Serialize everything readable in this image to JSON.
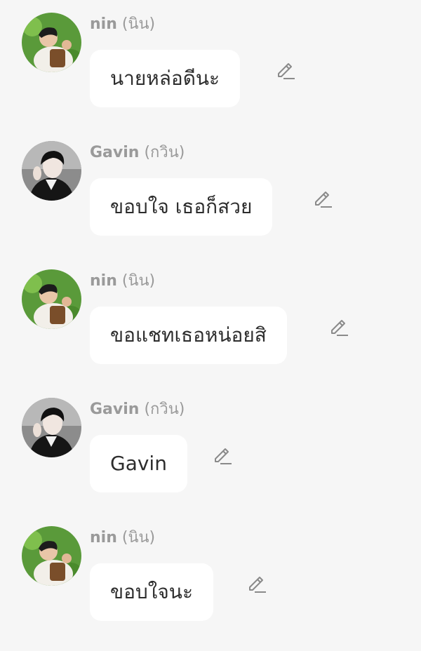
{
  "messages": [
    {
      "sender_name": "nin",
      "sender_alias": "(นิน)",
      "text": "นายหล่อดีนะ",
      "avatar": "nin-avatar",
      "edit_icon": "pencil-icon"
    },
    {
      "sender_name": "Gavin",
      "sender_alias": "(กวิน)",
      "text": "ขอบใจ เธอก็สวย",
      "avatar": "gavin-avatar",
      "edit_icon": "pencil-icon"
    },
    {
      "sender_name": "nin",
      "sender_alias": "(นิน)",
      "text": "ขอแชทเธอหน่อยสิ",
      "avatar": "nin-avatar",
      "edit_icon": "pencil-icon"
    },
    {
      "sender_name": "Gavin",
      "sender_alias": "(กวิน)",
      "text": "Gavin",
      "avatar": "gavin-avatar",
      "edit_icon": "pencil-icon"
    },
    {
      "sender_name": "nin",
      "sender_alias": "(นิน)",
      "text": "ขอบใจนะ",
      "avatar": "nin-avatar",
      "edit_icon": "pencil-icon"
    }
  ],
  "colors": {
    "background": "#f6f6f6",
    "bubble": "#ffffff",
    "sender_text": "#9a9a9a",
    "message_text": "#2d2d2d",
    "icon": "#8a8a8a"
  }
}
